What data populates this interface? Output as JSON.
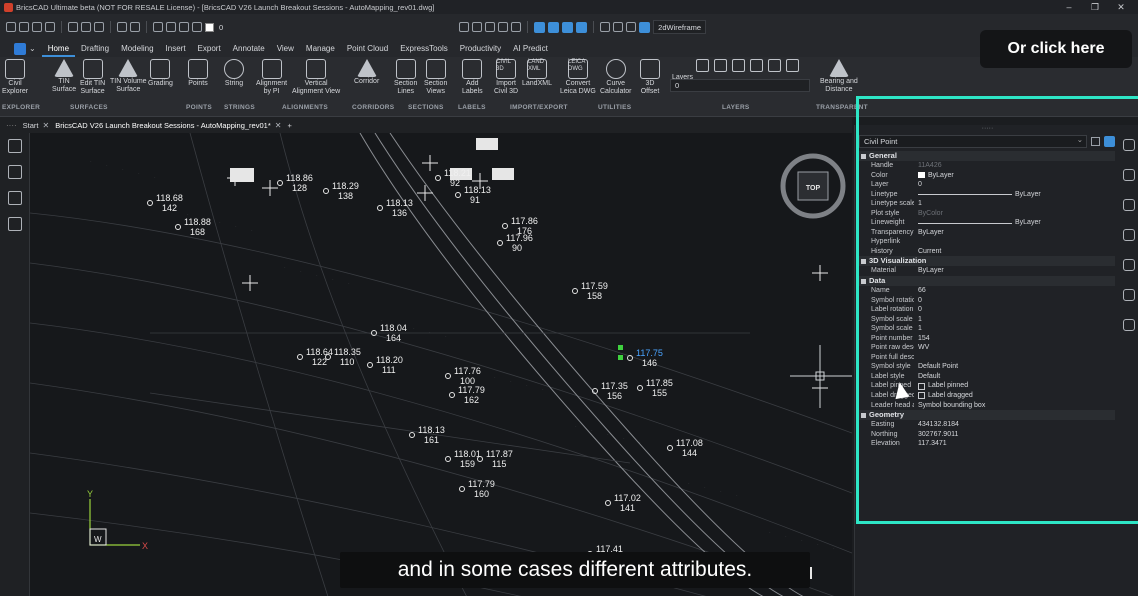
{
  "app": {
    "window_title": "BricsCAD Ultimate beta (NOT FOR RESALE License) - [BricsCAD V26 Launch Breakout Sessions - AutoMapping_rev01.dwg]",
    "min": "–",
    "max": "❐",
    "close": "✕"
  },
  "quickaccess": {
    "layer_value": "0",
    "visual_style": "2dWireframe"
  },
  "menu": {
    "tabs": [
      "Home",
      "Drafting",
      "Modeling",
      "Insert",
      "Export",
      "Annotate",
      "View",
      "Manage",
      "Point Cloud",
      "ExpressTools",
      "Productivity",
      "AI Predict"
    ],
    "active": "Home"
  },
  "ribbon": {
    "tools": [
      {
        "label": "Civil\nExplorer"
      },
      {
        "label": "TIN\nSurface"
      },
      {
        "label": "Edit TIN\nSurface"
      },
      {
        "label": "TIN Volume\nSurface"
      },
      {
        "label": "Grading"
      },
      {
        "label": "Points"
      },
      {
        "label": "String"
      },
      {
        "label": "Alignment\nby PI"
      },
      {
        "label": "Vertical\nAlignment View"
      },
      {
        "label": "Corridor"
      },
      {
        "label": "Section\nLines"
      },
      {
        "label": "Section\nViews"
      },
      {
        "label": "Add\nLabels"
      },
      {
        "label": "Import\nCivil 3D"
      },
      {
        "label": "LandXML"
      },
      {
        "label": "Convert\nLeica DWG"
      },
      {
        "label": "Curve\nCalculator"
      },
      {
        "label": "3D\nOffset"
      },
      {
        "label": "Layers"
      },
      {
        "label": "Bearing and\nDistance"
      }
    ],
    "icon_texts": {
      "civil3d": "CIVIL\n3D",
      "land_xml": "LAND\nXML",
      "leica_dwg": "LEICA\nDWG"
    },
    "groups": [
      "EXPLORER",
      "SURFACES",
      "POINTS",
      "STRINGS",
      "ALIGNMENTS",
      "CORRIDORS",
      "SECTIONS",
      "LABELS",
      "IMPORT/EXPORT",
      "UTILITIES",
      "LAYERS",
      "TRANSPARENT"
    ],
    "layer_value": "0"
  },
  "doc_tabs": [
    {
      "label": "Start",
      "active": false
    },
    {
      "label": "BricsCAD V26 Launch Breakout Sessions - AutoMapping_rev01*",
      "active": true
    }
  ],
  "canvas": {
    "viewcube_label": "TOP",
    "ucs_x": "X",
    "ucs_y": "Y",
    "ucs_w": "W",
    "points": [
      {
        "elev": "118.86",
        "num": "128"
      },
      {
        "elev": "118.29",
        "num": "138"
      },
      {
        "elev": "118.68",
        "num": "142"
      },
      {
        "elev": "118.13",
        "num": "136"
      },
      {
        "elev": "118.21",
        "num": "92"
      },
      {
        "elev": "118.13",
        "num": "91"
      },
      {
        "elev": "117.86",
        "num": "176"
      },
      {
        "elev": "117.96",
        "num": "90"
      },
      {
        "elev": "118.88",
        "num": "168"
      },
      {
        "elev": "117.59",
        "num": "158"
      },
      {
        "elev": "118.04",
        "num": "164"
      },
      {
        "elev": "118.64",
        "num": "122"
      },
      {
        "elev": "118.35",
        "num": "110"
      },
      {
        "elev": "118.20",
        "num": "111"
      },
      {
        "elev": "117.76",
        "num": "100"
      },
      {
        "elev": "117.79",
        "num": "162"
      },
      {
        "elev": "117.75",
        "num": "146"
      },
      {
        "elev": "117.35",
        "num": "156"
      },
      {
        "elev": "117.85",
        "num": "155"
      },
      {
        "elev": "118.13",
        "num": "161"
      },
      {
        "elev": "118.01",
        "num": "159"
      },
      {
        "elev": "117.87",
        "num": "115"
      },
      {
        "elev": "117.79",
        "num": "160"
      },
      {
        "elev": "117.08",
        "num": "144"
      },
      {
        "elev": "117.02",
        "num": "141"
      },
      {
        "elev": "117.41",
        "num": ""
      }
    ]
  },
  "properties": {
    "selected_type": "Civil Point",
    "categories": [
      {
        "name": "General",
        "rows": [
          {
            "k": "Handle",
            "v": "11A426",
            "dim": true
          },
          {
            "k": "Color",
            "v": "ByLayer",
            "swatch": true
          },
          {
            "k": "Layer",
            "v": "0"
          },
          {
            "k": "Linetype",
            "v": "ByLayer",
            "line": true
          },
          {
            "k": "Linetype scale",
            "v": "1"
          },
          {
            "k": "Plot style",
            "v": "ByColor",
            "dim": true
          },
          {
            "k": "Lineweight",
            "v": "ByLayer",
            "line": true
          },
          {
            "k": "Transparency",
            "v": "ByLayer"
          },
          {
            "k": "Hyperlink",
            "v": ""
          },
          {
            "k": "History",
            "v": "Current"
          }
        ]
      },
      {
        "name": "3D Visualization",
        "rows": [
          {
            "k": "Material",
            "v": "ByLayer"
          }
        ]
      },
      {
        "name": "Data",
        "rows": [
          {
            "k": "Name",
            "v": "66"
          },
          {
            "k": "Symbol rotation",
            "v": "0"
          },
          {
            "k": "Label rotation",
            "v": "0"
          },
          {
            "k": "Symbol scale X",
            "v": "1"
          },
          {
            "k": "Symbol scale Z",
            "v": "1"
          },
          {
            "k": "Point number",
            "v": "154"
          },
          {
            "k": "Point raw descr",
            "v": "WV"
          },
          {
            "k": "Point full descr",
            "v": ""
          },
          {
            "k": "Symbol style",
            "v": "Default Point"
          },
          {
            "k": "Label style",
            "v": "Default"
          },
          {
            "k": "Label pinned",
            "v": "Label pinned",
            "cb": true
          },
          {
            "k": "Label dragged",
            "v": "Label dragged",
            "cb": true
          },
          {
            "k": "Leader head att",
            "v": "Symbol bounding box"
          }
        ]
      },
      {
        "name": "Geometry",
        "rows": [
          {
            "k": "Easting",
            "v": "434132.8184"
          },
          {
            "k": "Northing",
            "v": "302767.9011"
          },
          {
            "k": "Elevation",
            "v": "117.3471"
          }
        ]
      }
    ]
  },
  "overlay": {
    "callout": "Or click here",
    "caption": "and in some cases different attributes."
  },
  "colors": {
    "accent": "#3d8fd9",
    "highlight": "#2ee6c6",
    "selected_point": "#4aa3ff",
    "grip": "#3fd13f"
  }
}
